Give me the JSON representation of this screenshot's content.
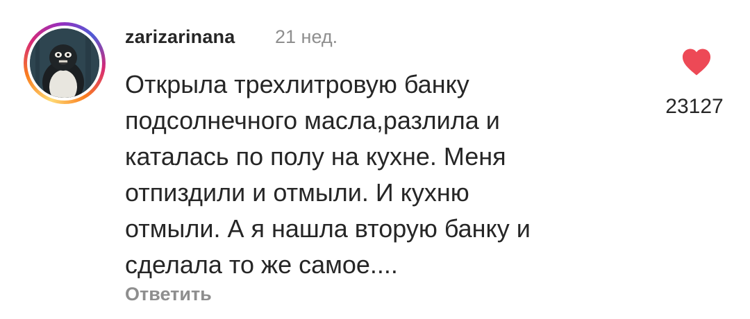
{
  "comment": {
    "username": "zarizarinana",
    "time": "21 нед.",
    "text_lines": [
      "Открыла трехлитровую банку",
      "подсолнечного масла,разлила и",
      "каталась по полу на кухне. Меня",
      "отпиздили и отмыли. И кухню",
      "отмыли. А я нашла вторую банку и",
      "сделала то же самое...."
    ],
    "reply_label": "Ответить",
    "likes": "23127",
    "like_icon": "heart-icon",
    "like_color": "#ed4956",
    "avatar_icon": "penguin-avatar"
  }
}
